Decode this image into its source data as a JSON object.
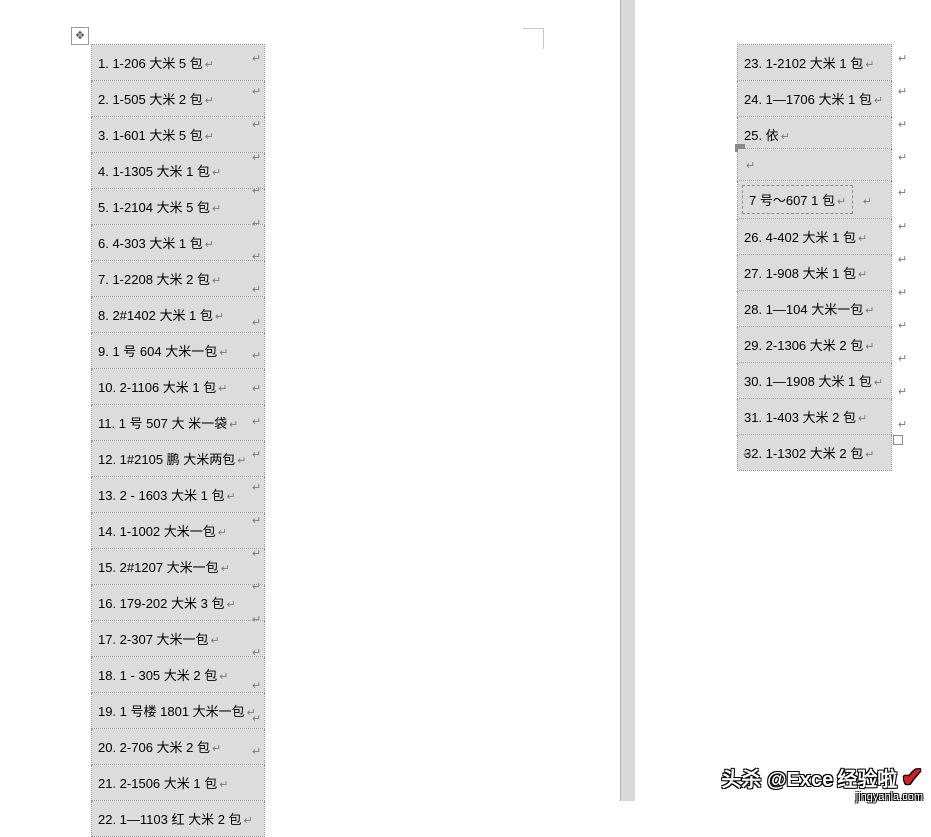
{
  "left_table": {
    "rows": [
      "1. 1-206  大米 5 包",
      "2. 1-505  大米 2 包",
      "3. 1-601  大米 5 包",
      "4. 1-1305  大米 1 包",
      "5. 1-2104  大米 5 包",
      "6. 4-303  大米  1 包",
      "7. 1-2208  大米 2 包",
      "8. 2#1402  大米 1 包",
      "9. 1 号 604  大米一包",
      "10. 2-1106  大米 1 包",
      "11. 1 号 507  大 米一袋",
      "12. 1#2105 鹏  大米两包",
      "13. 2 - 1603  大米 1 包",
      "14. 1-1002  大米一包",
      "15. 2#1207  大米一包",
      "16. 179-202  大米 3 包",
      "17. 2-307    大米一包",
      "18. 1 - 305  大米 2 包",
      "19. 1 号楼 1801  大米一包",
      "20. 2-706  大米 2 包",
      "21. 2-1506  大米 1 包",
      "22. 1—1103 红  大米 2 包"
    ]
  },
  "right_table": {
    "rows_top": [
      "23. 1-2102 大米 1 包",
      "24. 1—1706 大米 1 包",
      "25. 依"
    ],
    "special_row": "7 号～607 1 包",
    "rows_bottom": [
      "26. 4-402  大米 1 包",
      "27. 1-908 大米 1 包",
      "28. 1—104  大米一包",
      "29. 2-1306  大米 2 包",
      "30. 1—1908  大米 1 包",
      "31. 1-403  大米 2 包",
      "32. 1-1302  大米 2 包"
    ]
  },
  "watermark": {
    "main1": "头杀 @Exce",
    "main2": "经验啦",
    "sub": "jingyanla.com"
  }
}
